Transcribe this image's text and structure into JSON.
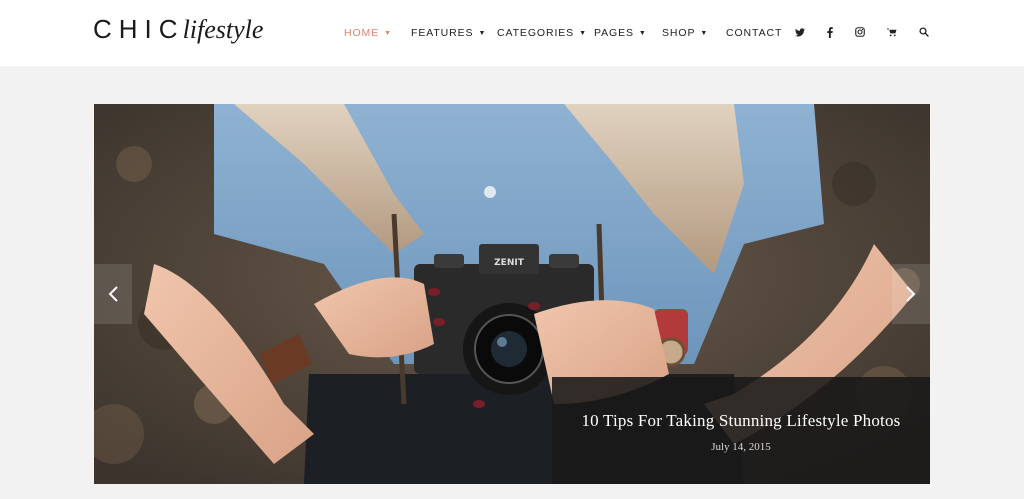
{
  "brand": {
    "name": "CHIC",
    "tagline": "lifestyle"
  },
  "nav": {
    "items": [
      {
        "label": "HOME",
        "active": true,
        "has_dropdown": true
      },
      {
        "label": "FEATURES",
        "active": false,
        "has_dropdown": true
      },
      {
        "label": "CATEGORIES",
        "active": false,
        "has_dropdown": true
      },
      {
        "label": "PAGES",
        "active": false,
        "has_dropdown": true
      },
      {
        "label": "SHOP",
        "active": false,
        "has_dropdown": true
      },
      {
        "label": "CONTACT",
        "active": false,
        "has_dropdown": false
      }
    ],
    "icons": [
      "twitter-icon",
      "facebook-icon",
      "instagram-icon",
      "cart-icon",
      "search-icon"
    ]
  },
  "slider": {
    "title": "10 Tips For Taking Stunning Lifestyle Photos",
    "date": "July 14, 2015",
    "prev_icon": "chevron-left-icon",
    "next_icon": "chevron-right-icon"
  },
  "colors": {
    "accent": "#e5826b",
    "text": "#222222",
    "page_bg": "#f2f2f2",
    "header_bg": "#ffffff",
    "caption_bg": "#191919"
  }
}
